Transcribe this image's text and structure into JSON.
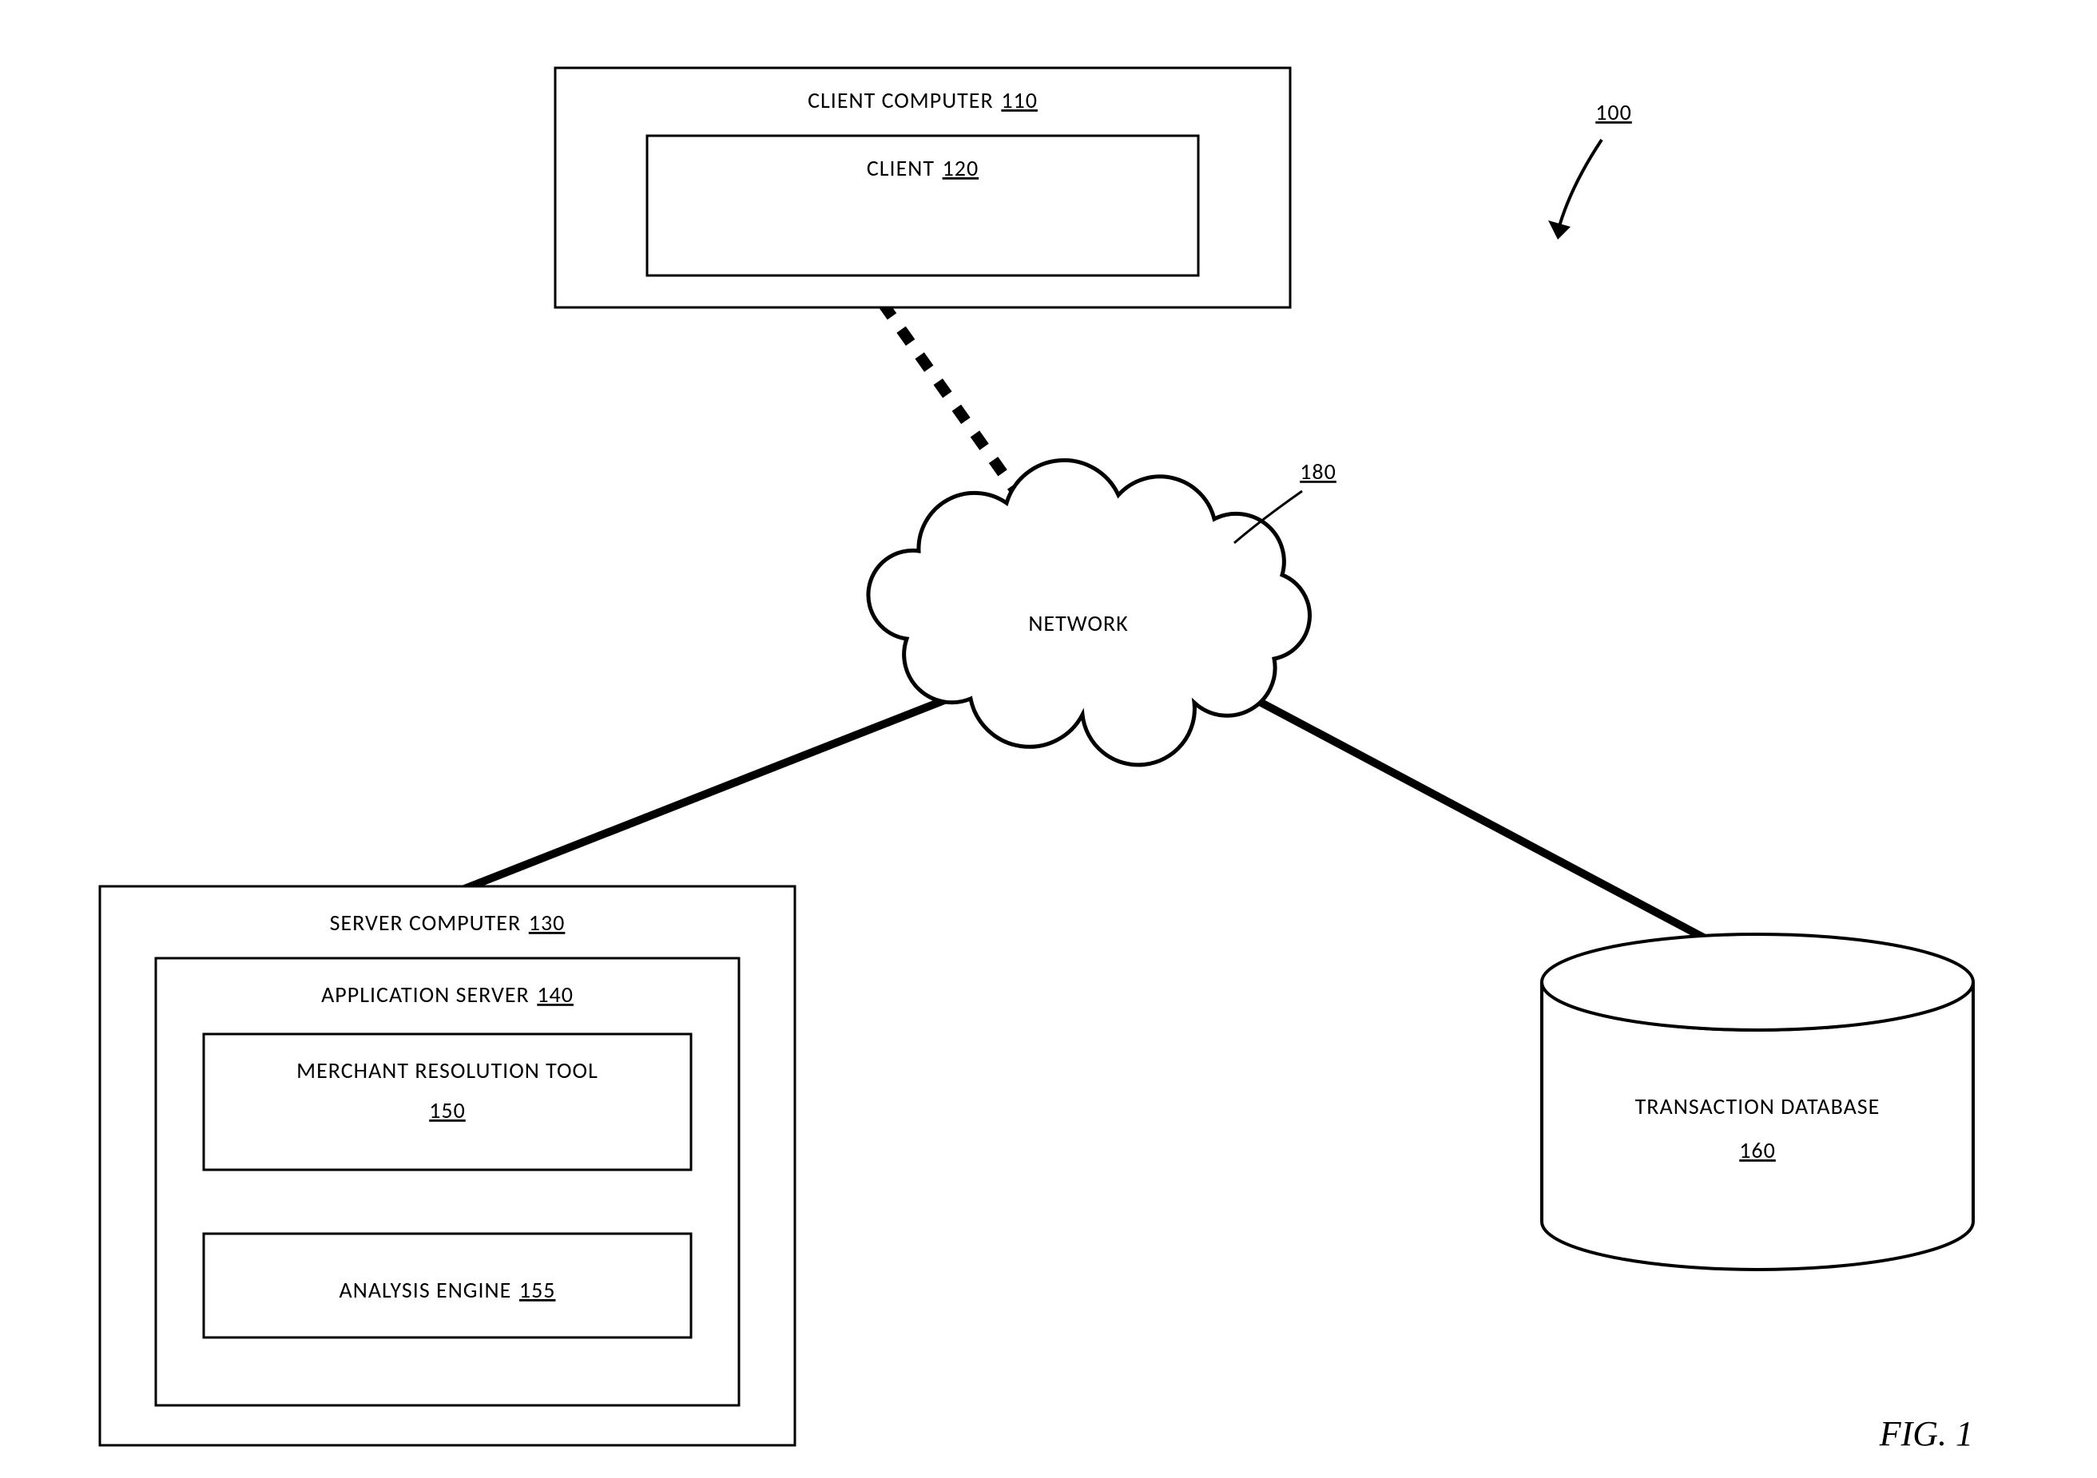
{
  "figure": {
    "label": "FIG. 1",
    "ref": "100"
  },
  "client_computer": {
    "label": "CLIENT COMPUTER",
    "ref": "110"
  },
  "client": {
    "label": "CLIENT",
    "ref": "120"
  },
  "server_computer": {
    "label": "SERVER COMPUTER",
    "ref": "130"
  },
  "app_server": {
    "label": "APPLICATION SERVER",
    "ref": "140"
  },
  "merchant_tool": {
    "label": "MERCHANT RESOLUTION TOOL",
    "ref": "150"
  },
  "analysis_engine": {
    "label": "ANALYSIS ENGINE",
    "ref": "155"
  },
  "database": {
    "label": "TRANSACTION DATABASE",
    "ref": "160"
  },
  "network": {
    "label": "NETWORK",
    "ref": "180"
  }
}
